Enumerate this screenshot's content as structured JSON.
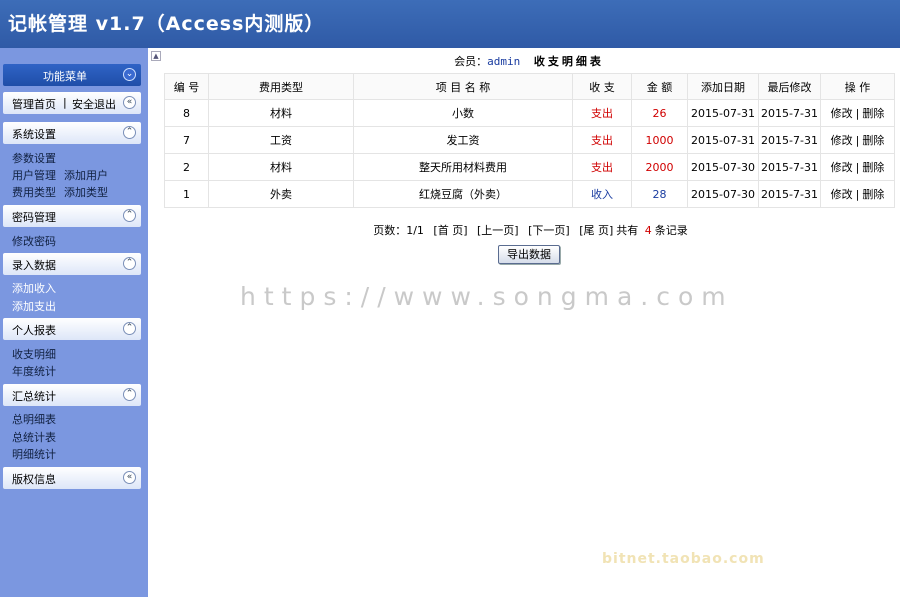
{
  "app": {
    "title": "记帐管理 v1.7（Access内测版）"
  },
  "sidebar": {
    "menu_title": "功能菜单",
    "top_links": {
      "home": "管理首页",
      "divider": "|",
      "logout": "安全退出"
    },
    "groups": [
      {
        "title": "系统设置",
        "items": [
          [
            "参数设置"
          ],
          [
            "用户管理",
            "添加用户"
          ],
          [
            "费用类型",
            "添加类型"
          ]
        ]
      },
      {
        "title": "密码管理",
        "items": [
          [
            "修改密码"
          ]
        ]
      },
      {
        "title": "录入数据",
        "items": [
          [
            "添加收入"
          ],
          [
            "添加支出"
          ]
        ]
      },
      {
        "title": "个人报表",
        "items": [
          [
            "收支明细"
          ],
          [
            "年度统计"
          ]
        ]
      },
      {
        "title": "汇总统计",
        "items": [
          [
            "总明细表"
          ],
          [
            "总统计表"
          ],
          [
            "明细统计"
          ]
        ]
      },
      {
        "title": "版权信息",
        "items": []
      }
    ]
  },
  "main": {
    "caption_prefix": "会员：",
    "username": "admin",
    "caption": "收支明细表",
    "columns": [
      "编 号",
      "费用类型",
      "项 目 名 称",
      "收 支",
      "金 额",
      "添加日期",
      "最后修改",
      "操 作"
    ],
    "rows": [
      {
        "id": "8",
        "type": "材料",
        "name": "小数",
        "kind": "支出",
        "amount": "26",
        "added": "2015-07-31",
        "modified": "2015-7-31",
        "edit": "修改",
        "sep": "|",
        "del": "删除"
      },
      {
        "id": "7",
        "type": "工资",
        "name": "发工资",
        "kind": "支出",
        "amount": "1000",
        "added": "2015-07-31",
        "modified": "2015-7-31",
        "edit": "修改",
        "sep": "|",
        "del": "删除"
      },
      {
        "id": "2",
        "type": "材料",
        "name": "整天所用材料费用",
        "kind": "支出",
        "amount": "2000",
        "added": "2015-07-30",
        "modified": "2015-7-31",
        "edit": "修改",
        "sep": "|",
        "del": "删除"
      },
      {
        "id": "1",
        "type": "外卖",
        "name": "红烧豆腐（外卖）",
        "kind": "收入",
        "amount": "28",
        "added": "2015-07-30",
        "modified": "2015-7-31",
        "edit": "修改",
        "sep": "|",
        "del": "删除"
      }
    ],
    "pager": {
      "pages": "页数：1/1",
      "first": "[首 页]",
      "prev": "[上一页]",
      "next": "[下一页]",
      "last": "[尾 页]",
      "total_prefix": "共有",
      "total": "4",
      "total_suffix": "条记录"
    },
    "export_label": "导出数据"
  },
  "watermarks": {
    "url": "https://www.songma.com",
    "shop": "bitnet.taobao.com"
  },
  "colors": {
    "header": "#2f5aa6",
    "sidebar": "#7b97e0",
    "expense": "#d00000",
    "income": "#1a3ca0"
  }
}
